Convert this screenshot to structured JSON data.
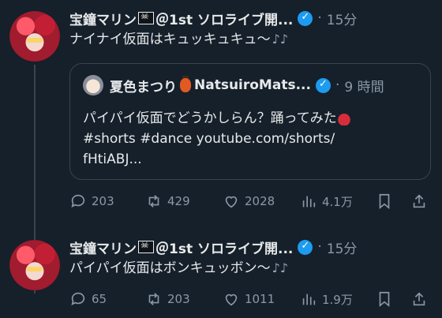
{
  "tweets": [
    {
      "author_name": "宝鐘マリン",
      "author_suffix": "＠1st ソロライブ開...",
      "time": "15分",
      "text": "ナイナイ仮面はキュッキュキュ〜",
      "quote": {
        "author_name": "夏色まつり",
        "author_suffix": "NatsuiroMats...",
        "time": "9 時間",
        "line1": "パイパイ仮面でどうかしらん？踊ってみた",
        "line2": "#shorts #dance youtube.com/shorts/",
        "line3": "fHtiABJ..."
      },
      "stats": {
        "replies": "203",
        "retweets": "429",
        "likes": "2028",
        "views": "4.1万"
      }
    },
    {
      "author_name": "宝鐘マリン",
      "author_suffix": "＠1st ソロライブ開...",
      "time": "15分",
      "text": "パイパイ仮面はボンキュッボン〜",
      "stats": {
        "replies": "65",
        "retweets": "203",
        "likes": "1011",
        "views": "1.9万"
      }
    }
  ],
  "separator_dot": "·",
  "music_note": "♪♪",
  "colors": {
    "background": "#15202b",
    "muted": "#8b98a5",
    "verified": "#1d9bf0",
    "border": "#38444d"
  }
}
